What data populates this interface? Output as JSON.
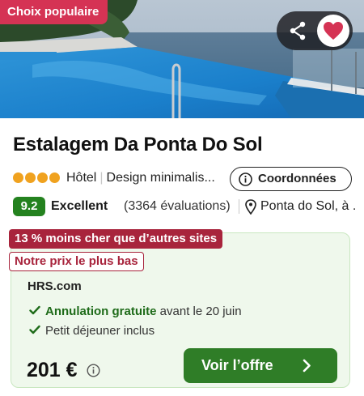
{
  "hero": {
    "badge": "Choix populaire",
    "share_icon": "share-icon",
    "favorite_icon": "heart-icon",
    "accent": "#d53354"
  },
  "hotel": {
    "name": "Estalagem Da Ponta Do Sol",
    "star_rating": 4,
    "type": "Hôtel",
    "description": "Design minimalis...",
    "coordinates_button": "Coordonnées"
  },
  "rating": {
    "score": "9.2",
    "label": "Excellent",
    "count": "(3364 évaluations)",
    "location": "Ponta do Sol, à ...",
    "score_color": "#24821f"
  },
  "deal": {
    "tag_cheaper": "13 % moins cher que d’autres sites",
    "tag_lowest": "Notre prix le plus bas",
    "provider": "HRS.com",
    "perks": [
      {
        "bold": "Annulation gratuite",
        "rest": " avant le 20 juin"
      },
      {
        "bold": "",
        "rest": "Petit déjeuner inclus"
      }
    ],
    "price": "201 €",
    "cta": "Voir l’offre",
    "tag_color": "#a8243c",
    "cta_color": "#2f7d27"
  }
}
